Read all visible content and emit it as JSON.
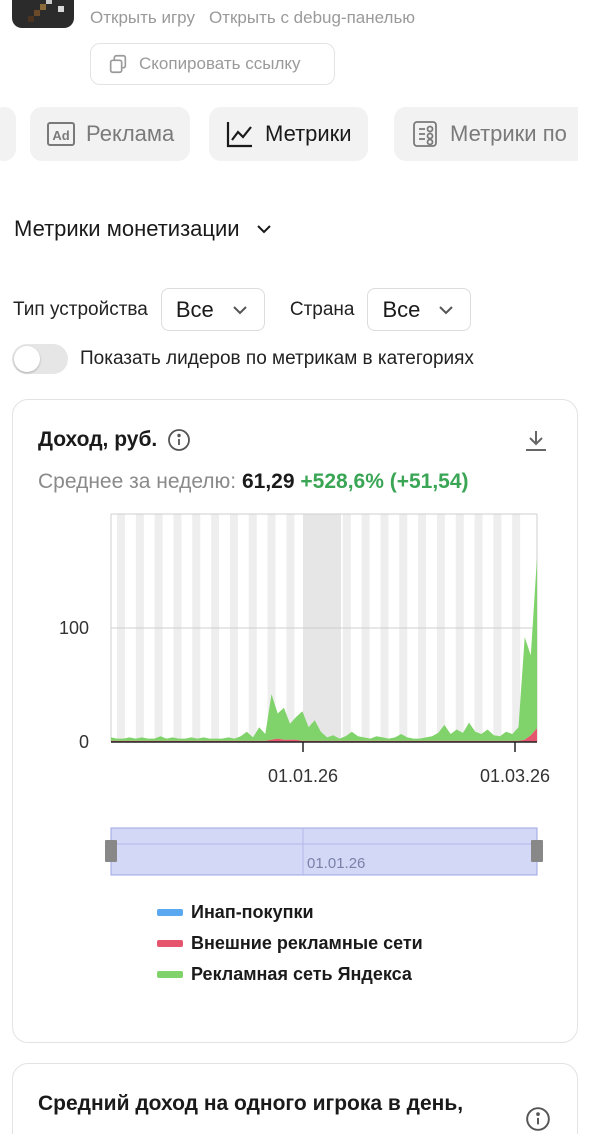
{
  "header": {
    "open_game": "Открыть игру",
    "open_debug": "Открыть с debug-панелью",
    "copy_link": "Скопировать ссылку"
  },
  "tabs": [
    {
      "label": "Реклама",
      "icon": "ad-icon",
      "active": false
    },
    {
      "label": "Метрики",
      "icon": "line-chart-icon",
      "active": true
    },
    {
      "label": "Метрики по",
      "icon": "stacked-coins-icon",
      "active": false
    }
  ],
  "section": {
    "title": "Метрики монетизации"
  },
  "filters": {
    "device_label": "Тип устройства",
    "device_value": "Все",
    "country_label": "Страна",
    "country_value": "Все"
  },
  "toggle": {
    "label": "Показать лидеров по метрикам в категориях",
    "checked": false
  },
  "revenue_card": {
    "title": "Доход, руб.",
    "avg_label": "Среднее за неделю:",
    "avg_value": "61,29",
    "avg_delta": "+528,6% (+51,54)"
  },
  "chart_data": {
    "type": "area",
    "x_ticks": [
      "01.01.26",
      "01.03.26"
    ],
    "y_ticks": [
      0,
      100
    ],
    "ylim": [
      0,
      200
    ],
    "grid": true,
    "range_selector_label": "01.01.26",
    "series": [
      {
        "name": "Инап-покупки",
        "color": "#5aa9f0",
        "values": [
          0,
          0,
          0,
          0,
          0,
          0,
          0,
          0,
          0,
          0,
          0,
          0,
          0,
          0,
          0,
          0,
          0,
          0,
          0,
          0,
          0,
          0,
          0,
          0,
          0,
          0,
          0,
          0,
          0,
          0,
          0,
          0,
          0,
          0,
          0,
          0,
          0,
          0,
          0,
          0,
          0,
          0,
          0,
          0,
          0,
          0,
          0,
          0,
          0,
          0,
          0,
          0,
          0,
          0,
          0,
          0,
          0,
          0,
          0,
          0,
          0,
          0,
          0,
          0,
          0,
          0,
          0,
          0,
          0,
          0
        ]
      },
      {
        "name": "Внешние рекламные сети",
        "color": "#e5566e",
        "values": [
          1,
          1,
          1,
          1,
          1,
          1,
          1,
          1,
          1,
          1,
          1,
          1,
          1,
          1,
          1,
          1,
          1,
          1,
          1,
          1,
          1,
          1,
          1,
          1,
          1,
          1,
          2,
          3,
          2,
          2,
          2,
          1,
          1,
          1,
          1,
          1,
          1,
          1,
          1,
          1,
          1,
          1,
          1,
          1,
          1,
          1,
          1,
          1,
          1,
          1,
          1,
          1,
          1,
          1,
          1,
          1,
          1,
          1,
          1,
          1,
          1,
          1,
          1,
          1,
          1,
          1,
          1,
          2,
          6,
          12
        ]
      },
      {
        "name": "Рекламная сеть Яндекса",
        "color": "#7fd36a",
        "values": [
          3,
          2,
          2,
          3,
          2,
          3,
          2,
          2,
          4,
          2,
          3,
          2,
          2,
          3,
          2,
          3,
          2,
          2,
          2,
          3,
          2,
          4,
          8,
          3,
          12,
          6,
          40,
          22,
          28,
          14,
          20,
          26,
          12,
          18,
          8,
          3,
          5,
          2,
          4,
          8,
          4,
          3,
          2,
          4,
          3,
          2,
          3,
          6,
          3,
          2,
          2,
          3,
          4,
          7,
          14,
          6,
          10,
          7,
          16,
          8,
          6,
          10,
          5,
          4,
          8,
          6,
          12,
          90,
          70,
          150
        ]
      }
    ]
  },
  "legend": [
    {
      "label": "Инап-покупки",
      "color": "#5aa9f0"
    },
    {
      "label": "Внешние рекламные сети",
      "color": "#e5566e"
    },
    {
      "label": "Рекламная сеть Яндекса",
      "color": "#7fd36a"
    }
  ],
  "second_card": {
    "title": "Средний доход на одного игрока в день,"
  }
}
